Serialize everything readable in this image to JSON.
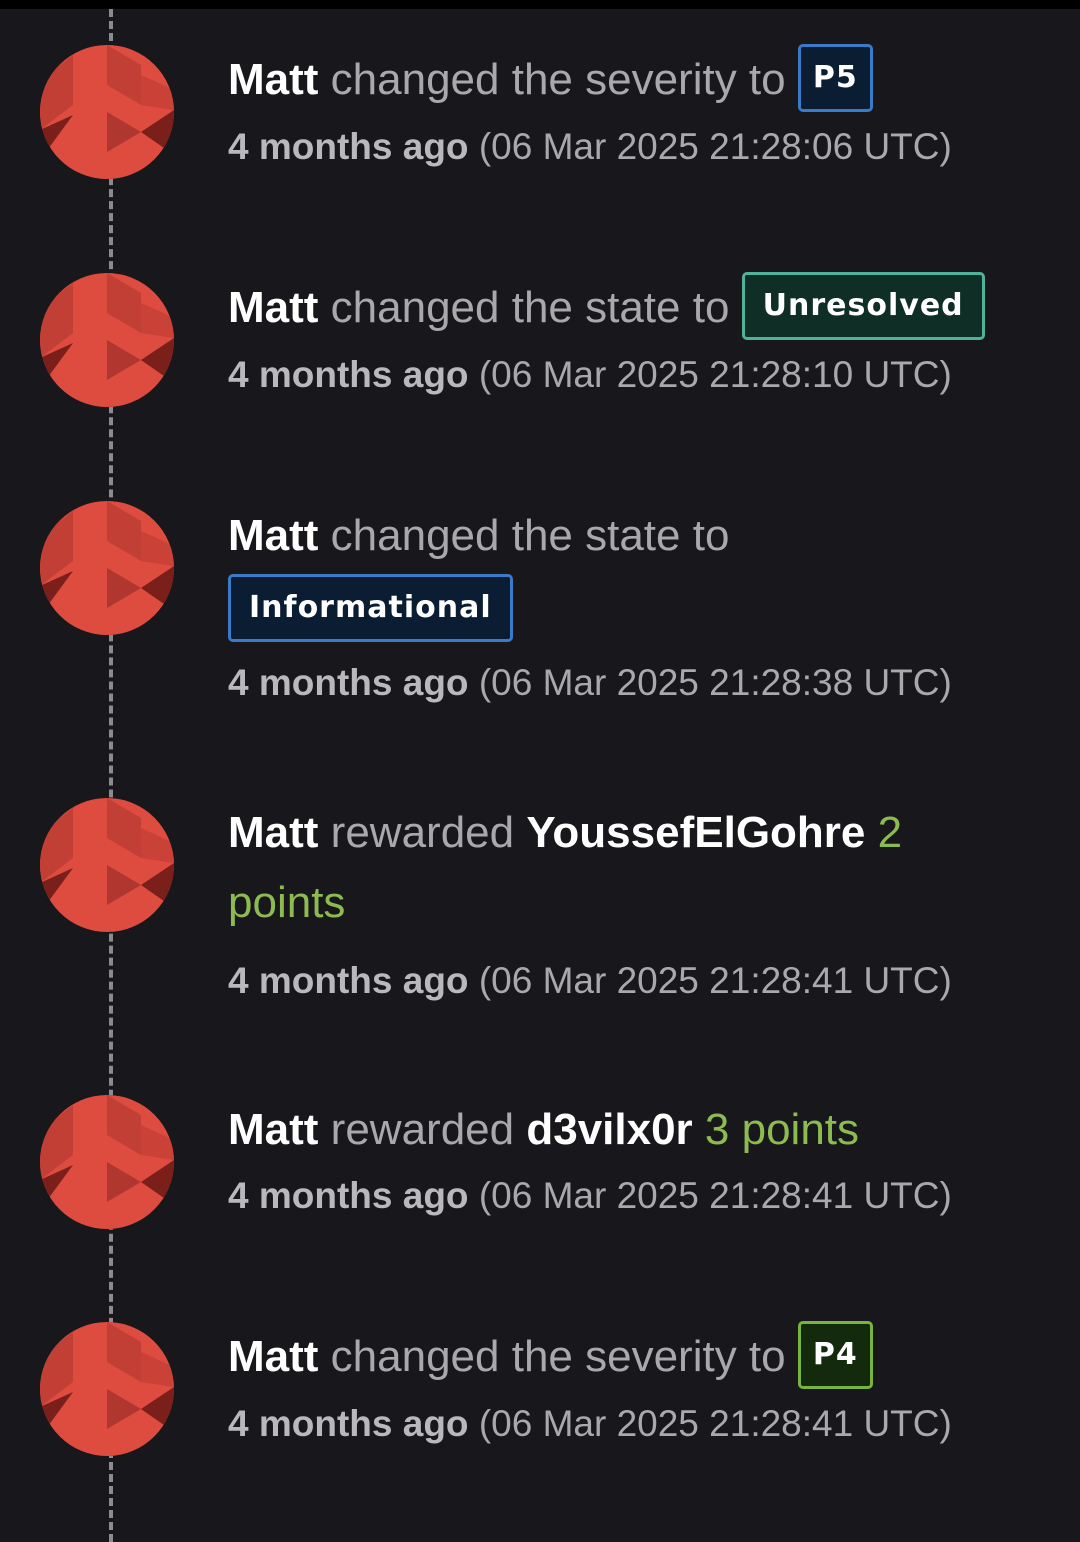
{
  "timeline": {
    "events": [
      {
        "actor": "Matt",
        "verb": "changed the severity to",
        "badge": "P5",
        "relative_time": "4 months ago",
        "absolute_time": "(06 Mar 2025 21:28:06 UTC)"
      },
      {
        "actor": "Matt",
        "verb": "changed the state to",
        "badge": "Unresolved",
        "relative_time": "4 months ago",
        "absolute_time": "(06 Mar 2025 21:28:10 UTC)"
      },
      {
        "actor": "Matt",
        "verb": "changed the state to",
        "badge": "Informational",
        "relative_time": "4 months ago",
        "absolute_time": "(06 Mar 2025 21:28:38 UTC)"
      },
      {
        "actor": "Matt",
        "verb": "rewarded",
        "recipient": "YoussefElGohre",
        "points_number": "2",
        "points_word": "points",
        "relative_time": "4 months ago",
        "absolute_time": "(06 Mar 2025 21:28:41 UTC)"
      },
      {
        "actor": "Matt",
        "verb": "rewarded",
        "recipient": "d3vilx0r",
        "points": "3 points",
        "relative_time": "4 months ago",
        "absolute_time": "(06 Mar 2025 21:28:41 UTC)"
      },
      {
        "actor": "Matt",
        "verb": "changed the severity to",
        "badge": "P4",
        "relative_time": "4 months ago",
        "absolute_time": "(06 Mar 2025 21:28:41 UTC)"
      }
    ]
  },
  "colors": {
    "background": "#17171c",
    "avatar_red": "#de4b3f",
    "points_green": "#8dbb4f",
    "badge_p5_border": "#3a7ac8",
    "badge_unresolved_border": "#4fb399",
    "badge_p4_border": "#77b33f"
  },
  "icons": {
    "avatar": "identicon-avatar-icon"
  }
}
